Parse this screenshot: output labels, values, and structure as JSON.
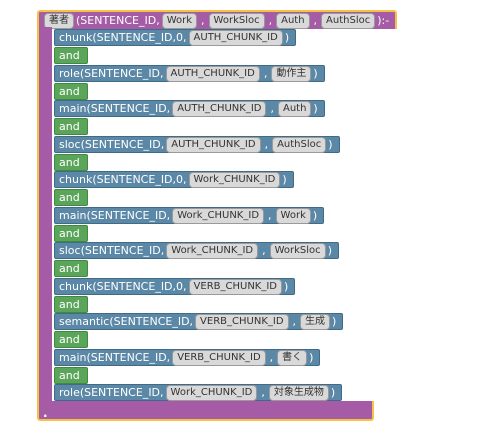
{
  "head": {
    "name": "著者",
    "open": " (SENTENCE_ID, ",
    "args": [
      "Work",
      "WorkSloc",
      "Auth",
      "AuthSloc"
    ],
    "close": " ):-"
  },
  "statements": [
    {
      "pre": "chunk(SENTENCE_ID,0, ",
      "args": [
        "AUTH_CHUNK_ID"
      ]
    },
    {
      "pre": "role(SENTENCE_ID, ",
      "args": [
        "AUTH_CHUNK_ID",
        "動作主"
      ]
    },
    {
      "pre": "main(SENTENCE_ID, ",
      "args": [
        "AUTH_CHUNK_ID",
        "Auth"
      ]
    },
    {
      "pre": "sloc(SENTENCE_ID, ",
      "args": [
        "AUTH_CHUNK_ID",
        "AuthSloc"
      ]
    },
    {
      "pre": "chunk(SENTENCE_ID,0, ",
      "args": [
        "Work_CHUNK_ID"
      ]
    },
    {
      "pre": "main(SENTENCE_ID, ",
      "args": [
        "Work_CHUNK_ID",
        "Work"
      ]
    },
    {
      "pre": "sloc(SENTENCE_ID, ",
      "args": [
        "Work_CHUNK_ID",
        "WorkSloc"
      ]
    },
    {
      "pre": "chunk(SENTENCE_ID,0, ",
      "args": [
        "VERB_CHUNK_ID"
      ]
    },
    {
      "pre": "semantic(SENTENCE_ID, ",
      "args": [
        "VERB_CHUNK_ID",
        "生成"
      ]
    },
    {
      "pre": "main(SENTENCE_ID, ",
      "args": [
        "VERB_CHUNK_ID",
        "書く"
      ]
    },
    {
      "pre": "role(SENTENCE_ID, ",
      "args": [
        "Work_CHUNK_ID",
        "対象生成物"
      ]
    }
  ],
  "conjunction": "and",
  "separator": ",",
  "close_paren": " )",
  "end_dot": "."
}
